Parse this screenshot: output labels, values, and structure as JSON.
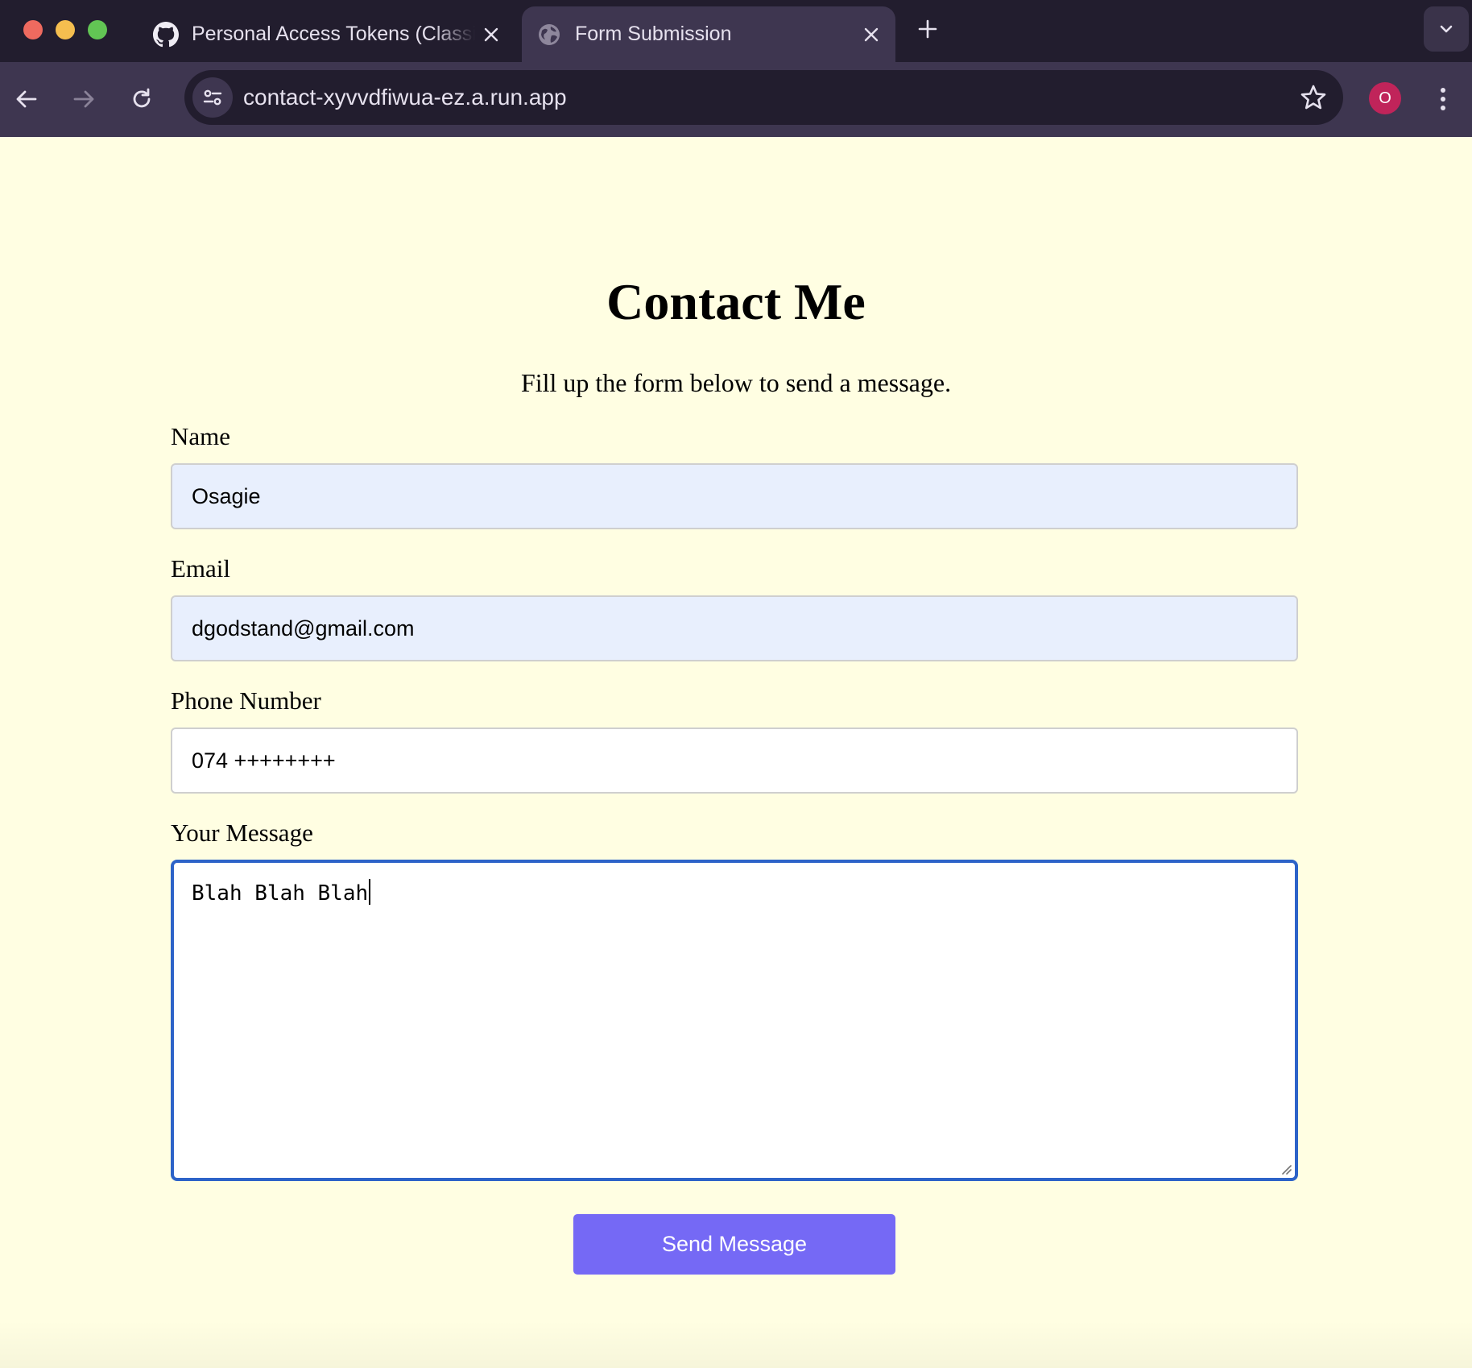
{
  "browser": {
    "tabs": [
      {
        "title": "Personal Access Tokens (Classic)",
        "icon": "github-icon",
        "active": false
      },
      {
        "title": "Form Submission",
        "icon": "globe-icon",
        "active": true
      }
    ],
    "url": "contact-xyvvdfiwua-ez.a.run.app",
    "profile_initial": "O",
    "colors": {
      "tabbar": "#221d2e",
      "toolbar": "#3e3650",
      "profile": "#c0245a"
    }
  },
  "page": {
    "title": "Contact Me",
    "subtitle": "Fill up the form below to send a message.",
    "background": "#fffee2",
    "form": {
      "name_label": "Name",
      "name_value": "Osagie",
      "email_label": "Email",
      "email_value": "dgodstand@gmail.com",
      "phone_label": "Phone Number",
      "phone_value": "074 ++++++++",
      "message_label": "Your Message",
      "message_value": "Blah Blah Blah",
      "submit_label": "Send Message",
      "submit_color": "#7569f5",
      "focus_color": "#2d63c8"
    }
  }
}
